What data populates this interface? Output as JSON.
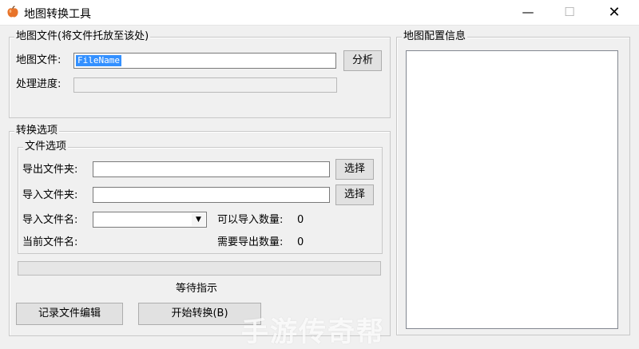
{
  "window": {
    "title": "地图转换工具",
    "icon": "apple-icon",
    "controls": {
      "minimize": "—",
      "maximize": "☐",
      "close": "✕"
    }
  },
  "map_file_group": {
    "legend": "地图文件(将文件托放至该处)",
    "file_label": "地图文件:",
    "file_value": "FileName",
    "analyze_button": "分析",
    "progress_label": "处理进度:"
  },
  "convert_group": {
    "legend": "转换选项",
    "file_options": {
      "legend": "文件选项",
      "export_folder_label": "导出文件夹:",
      "export_folder_value": "",
      "export_select_button": "选择",
      "import_folder_label": "导入文件夹:",
      "import_folder_value": "",
      "import_select_button": "选择",
      "import_filename_label": "导入文件名:",
      "import_filename_value": "",
      "importable_count_label": "可以导入数量:",
      "importable_count": "0",
      "current_filename_label": "当前文件名:",
      "export_count_label": "需要导出数量:",
      "export_count": "0"
    },
    "progress": 0,
    "status": "等待指示"
  },
  "buttons": {
    "edit_record": "记录文件编辑",
    "start_convert": "开始转换(B)"
  },
  "map_config_group": {
    "legend": "地图配置信息"
  },
  "watermark": "手游传奇帮",
  "colors": {
    "selection": "#3390ff",
    "background": "#f0f0f0"
  }
}
